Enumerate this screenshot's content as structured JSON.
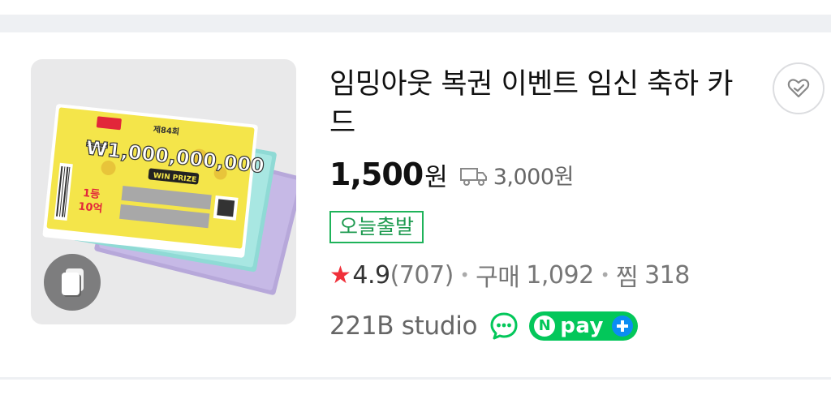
{
  "product": {
    "title": "임밍아웃 복권 이벤트 임신 축하 카드",
    "price": "1,500",
    "price_unit": "원",
    "shipping_fee": "3,000원",
    "badge": "오늘출발",
    "rating": "4.9",
    "review_count": "(707)",
    "purchase_label": "구매",
    "purchase_count": "1,092",
    "wish_label": "찜",
    "wish_count": "318",
    "seller": "221B studio"
  },
  "thumbnail": {
    "ticket_amount": "₩1,000,000,000",
    "ticket_sub": "WIN PRIZE",
    "ticket_prize": "1등\n10억",
    "ticket_round": "제84회"
  },
  "icons": {
    "multi": "multiple-images-icon",
    "wish": "heart-icon",
    "truck": "truck-icon",
    "talk": "talk-chat-icon",
    "npay": "npay-plus-icon",
    "star": "star-icon"
  },
  "npay": {
    "n": "N",
    "label": "pay"
  },
  "colors": {
    "accent_green": "#03c75a",
    "badge_green": "#1fb35a",
    "star_red": "#f0303a",
    "plus_blue": "#0b8df3"
  }
}
